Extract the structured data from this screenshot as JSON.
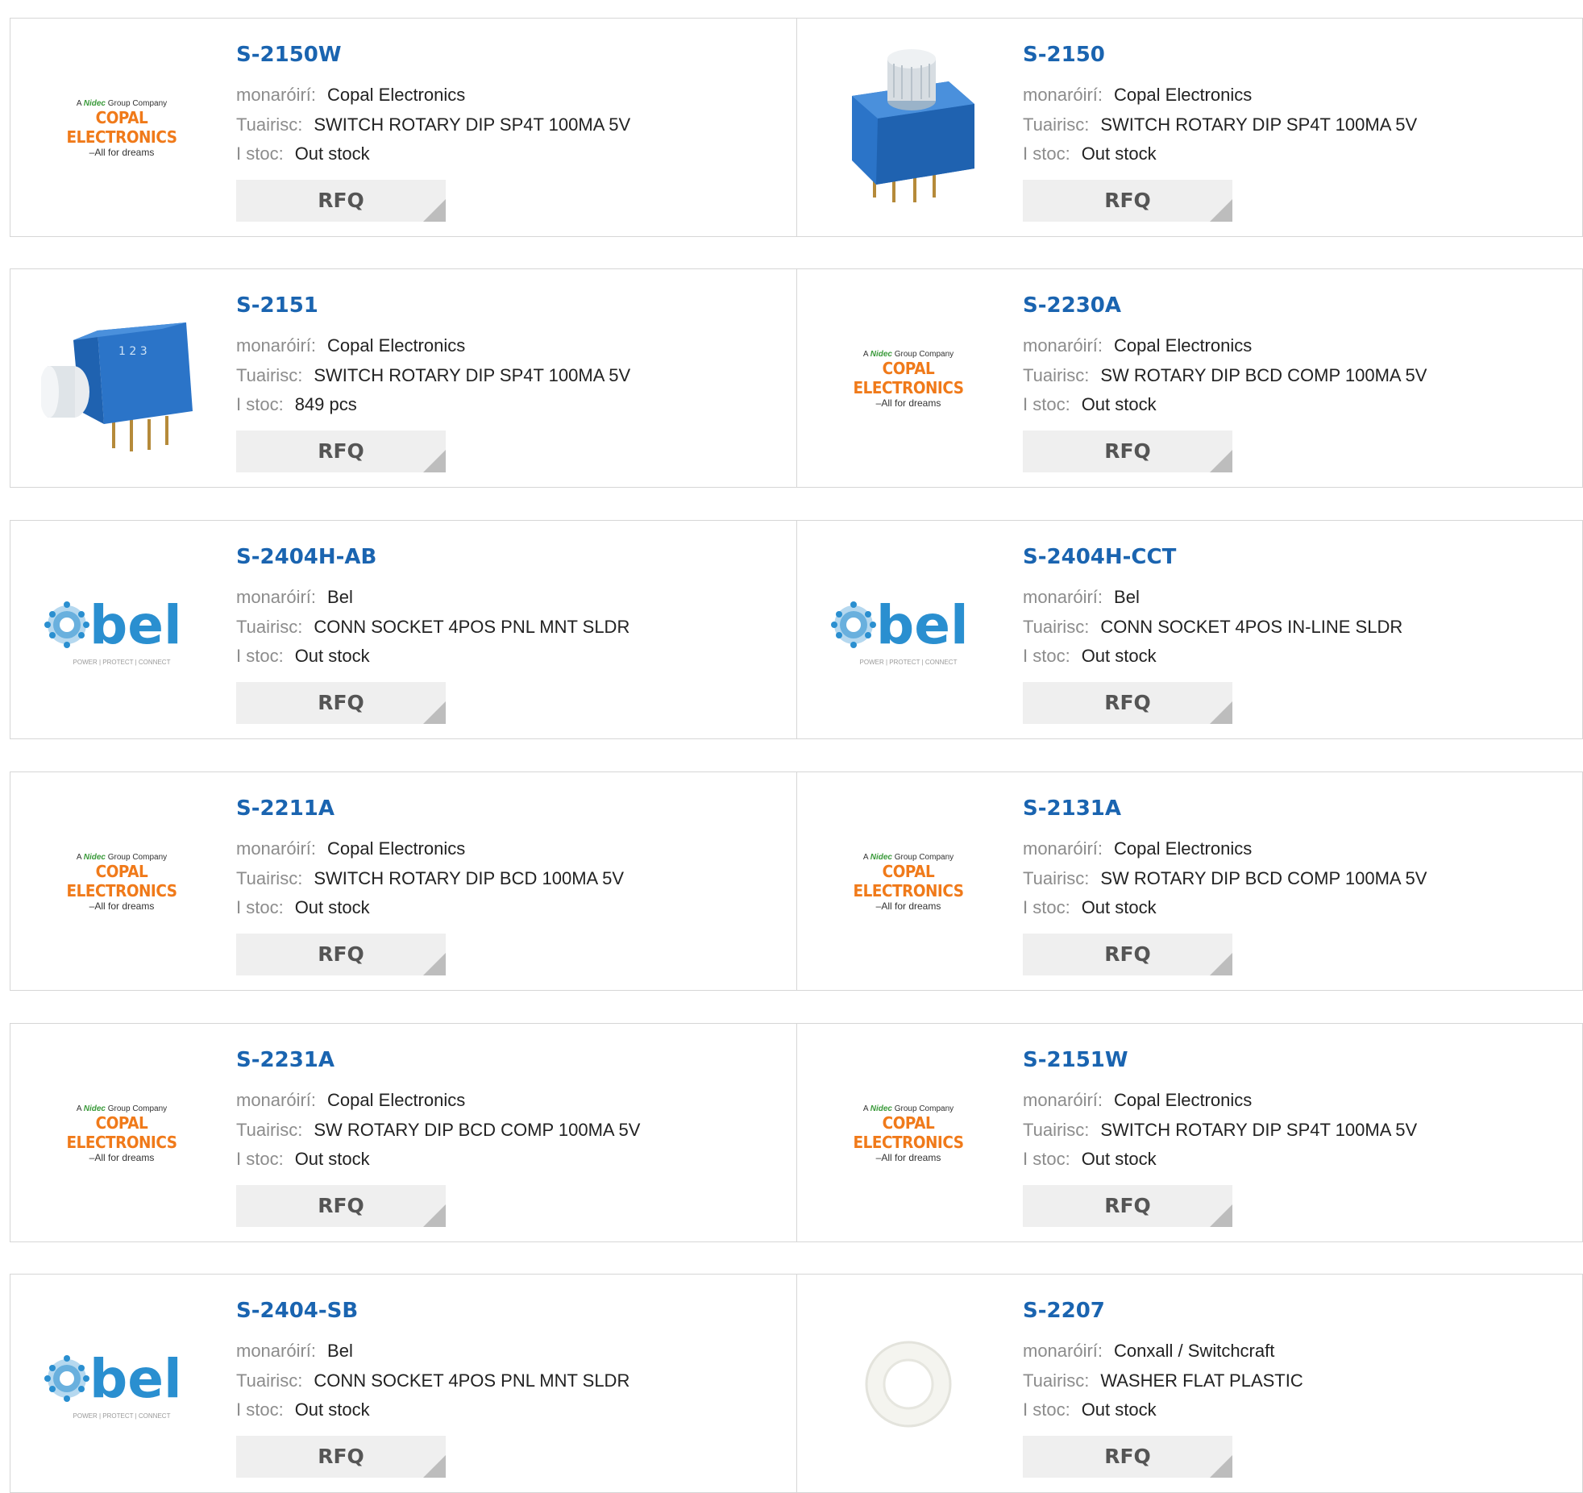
{
  "labels": {
    "manufacturer": "monaróirí:",
    "description": "Tuairisc:",
    "stock": "I stoc:",
    "rfq": "RFQ"
  },
  "logos": {
    "copal_top_a": "A",
    "copal_top_nidec": "Nidec",
    "copal_top_group": "Group Company",
    "copal_main": "COPAL ELECTRONICS",
    "copal_tag": "–All for dreams",
    "bel_word": "bel",
    "bel_tag": "POWER | PROTECT | CONNECT"
  },
  "products": [
    {
      "pn": "S-2150W",
      "manufacturer": "Copal Electronics",
      "description": "SWITCH ROTARY DIP SP4T 100MA 5V",
      "stock": "Out stock",
      "image": "copal-logo"
    },
    {
      "pn": "S-2150",
      "manufacturer": "Copal Electronics",
      "description": "SWITCH ROTARY DIP SP4T 100MA 5V",
      "stock": "Out stock",
      "image": "rotary-switch-vertical"
    },
    {
      "pn": "S-2151",
      "manufacturer": "Copal Electronics",
      "description": "SWITCH ROTARY DIP SP4T 100MA 5V",
      "stock": "849 pcs",
      "image": "rotary-switch-side"
    },
    {
      "pn": "S-2230A",
      "manufacturer": "Copal Electronics",
      "description": "SW ROTARY DIP BCD COMP 100MA 5V",
      "stock": "Out stock",
      "image": "copal-logo"
    },
    {
      "pn": "S-2404H-AB",
      "manufacturer": "Bel",
      "description": "CONN SOCKET 4POS PNL MNT SLDR",
      "stock": "Out stock",
      "image": "bel-logo"
    },
    {
      "pn": "S-2404H-CCT",
      "manufacturer": "Bel",
      "description": "CONN SOCKET 4POS IN-LINE SLDR",
      "stock": "Out stock",
      "image": "bel-logo"
    },
    {
      "pn": "S-2211A",
      "manufacturer": "Copal Electronics",
      "description": "SWITCH ROTARY DIP BCD 100MA 5V",
      "stock": "Out stock",
      "image": "copal-logo"
    },
    {
      "pn": "S-2131A",
      "manufacturer": "Copal Electronics",
      "description": "SW ROTARY DIP BCD COMP 100MA 5V",
      "stock": "Out stock",
      "image": "copal-logo"
    },
    {
      "pn": "S-2231A",
      "manufacturer": "Copal Electronics",
      "description": "SW ROTARY DIP BCD COMP 100MA 5V",
      "stock": "Out stock",
      "image": "copal-logo"
    },
    {
      "pn": "S-2151W",
      "manufacturer": "Copal Electronics",
      "description": "SWITCH ROTARY DIP SP4T 100MA 5V",
      "stock": "Out stock",
      "image": "copal-logo"
    },
    {
      "pn": "S-2404-SB",
      "manufacturer": "Bel",
      "description": "CONN SOCKET 4POS PNL MNT SLDR",
      "stock": "Out stock",
      "image": "bel-logo"
    },
    {
      "pn": "S-2207",
      "manufacturer": "Conxall / Switchcraft",
      "description": "WASHER FLAT PLASTIC",
      "stock": "Out stock",
      "image": "washer"
    }
  ],
  "colors": {
    "link": "#1a64b0",
    "label": "#8c8c8c",
    "value": "#222222",
    "copal_orange": "#f07a1a",
    "bel_blue": "#2a8fd0",
    "switch_blue": "#2b74c8"
  }
}
